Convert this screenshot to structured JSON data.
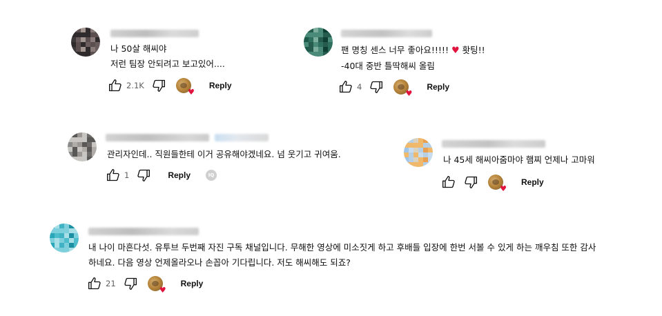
{
  "comments": [
    {
      "id": "c1",
      "lines": [
        "나 50살 해씨야",
        "저런 팀장 안되려고 보고있어...."
      ],
      "likes": "2.1K",
      "reply_label": "Reply",
      "avatar_colors": [
        "#3e3a3c",
        "#6a5d5e",
        "#8a7c7b",
        "#2f2a2b",
        "#a39590",
        "#5b4f50"
      ]
    },
    {
      "id": "c2",
      "line1_prefix": "팬 명칭 센스 너무 좋아요!!!!!",
      "line1_suffix": "홧팅!!",
      "line1_emoji": "♥",
      "line2": "-40대 중반 틀딱해씨 올림",
      "likes": "4",
      "reply_label": "Reply",
      "avatar_colors": [
        "#1e5a4a",
        "#2f6f5e",
        "#0e3f33",
        "#4a8a78",
        "#7cae9e",
        "#255c4d"
      ]
    },
    {
      "id": "c3",
      "lines": [
        "관리자인데.. 직원들한테 이거 공유해야겠네요. 넘 웃기고 귀여움."
      ],
      "likes": "1",
      "reply_label": "Reply",
      "avatar_colors": [
        "#8a8a8a",
        "#b0aca8",
        "#6e6c6a",
        "#c8c6c2",
        "#9a9794",
        "#5a5856"
      ]
    },
    {
      "id": "c4",
      "lines": [
        "나 45세 해씨아줌마야  햄찌 언제나 고마워"
      ],
      "likes": "",
      "reply_label": "Reply",
      "avatar_colors": [
        "#9fc6e8",
        "#c7ddef",
        "#e8a050",
        "#f0b86a",
        "#d9d2c0",
        "#b6cfe5"
      ]
    },
    {
      "id": "c5",
      "lines": [
        "내 나이 마흔다섯. 유투브 두번째 자진 구독 채널입니다. 무해한 영상에 미소짓게 하고 후배들 입장에 한번 서볼 수 있게 하는 깨우침 또한 감사",
        "하네요. 다음 영상 언제올라오나 손꼽아 기다립니다. 저도 해씨해도 되죠?"
      ],
      "likes": "21",
      "reply_label": "Reply",
      "avatar_colors": [
        "#29a6b8",
        "#4dbccb",
        "#1c8fa2",
        "#7ccfdb",
        "#3fb2c3",
        "#a8dee6"
      ]
    }
  ],
  "icons": {
    "like": "thumb-up-outline",
    "dislike": "thumb-down-outline",
    "hearted_by_creator": "creator-avatar-with-heart"
  },
  "colors": {
    "heart": "#e0143c",
    "meta": "#606060",
    "text": "#0f0f0f"
  }
}
